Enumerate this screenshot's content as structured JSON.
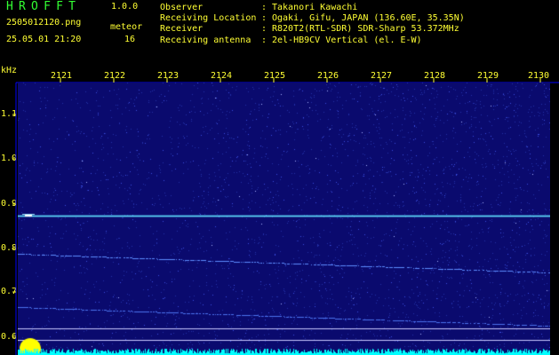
{
  "header": {
    "app_title": "HROFFT",
    "version": "1.0.0",
    "file_name": "2505012120.png",
    "meteor_label": "meteor",
    "datetime": "25.05.01 21:20",
    "meteor_count": "16",
    "info": [
      {
        "label": "Observer",
        "value": "Takanori Kawachi"
      },
      {
        "label": "Receiving Location",
        "value": "Ogaki, Gifu, JAPAN (136.60E, 35.35N)"
      },
      {
        "label": "Receiver",
        "value": "R820T2(RTL-SDR) SDR-Sharp 53.372MHz"
      },
      {
        "label": "Receiving antenna",
        "value": "2el-HB9CV Vertical (el. E-W)"
      }
    ],
    "separator": ":"
  },
  "axes": {
    "y_unit": "kHz",
    "x_ticks": [
      "2121",
      "2122",
      "2123",
      "2124",
      "2125",
      "2126",
      "2127",
      "2128",
      "2129",
      "2130"
    ],
    "y_ticks": [
      "1.1",
      "1.0",
      "0.9",
      "0.8",
      "0.7",
      "0.6"
    ]
  },
  "colors": {
    "background": "#0a0a6e",
    "noise": "#3344cc",
    "signal": "#5fe0ff",
    "baseline": "#00ffff",
    "burst": "#ffff00",
    "text": "#ffff33",
    "title": "#33ff33"
  }
}
